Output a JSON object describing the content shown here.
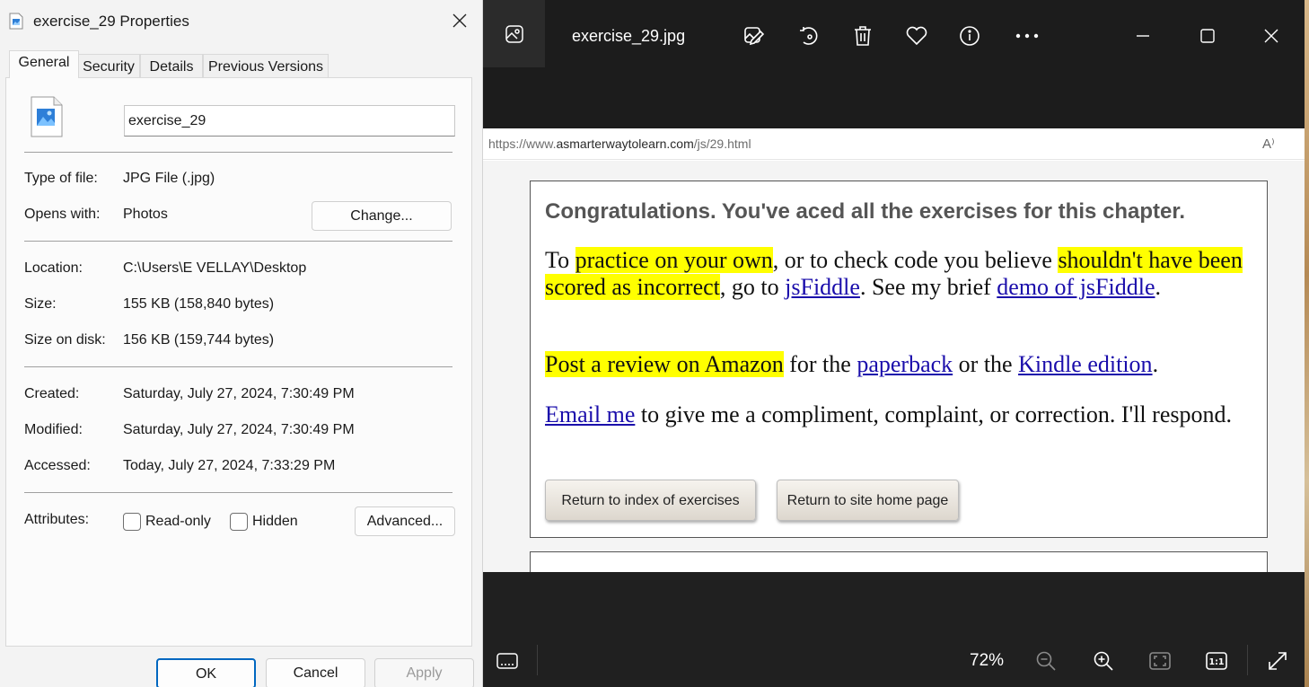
{
  "dialog": {
    "title": "exercise_29 Properties",
    "tabs": [
      "General",
      "Security",
      "Details",
      "Previous Versions"
    ],
    "file_name": "exercise_29",
    "type_label": "Type of file:",
    "type_value": "JPG File (.jpg)",
    "opens_label": "Opens with:",
    "opens_value": "Photos",
    "change_label": "Change...",
    "location_label": "Location:",
    "location_value": "C:\\Users\\E VELLAY\\Desktop",
    "size_label": "Size:",
    "size_value": "155 KB (158,840 bytes)",
    "size_disk_label": "Size on disk:",
    "size_disk_value": "156 KB (159,744 bytes)",
    "created_label": "Created:",
    "created_value": "Saturday, July 27, 2024, 7:30:49 PM",
    "modified_label": "Modified:",
    "modified_value": "Saturday, July 27, 2024, 7:30:49 PM",
    "accessed_label": "Accessed:",
    "accessed_value": "Today, July 27, 2024, 7:33:29 PM",
    "attributes_label": "Attributes:",
    "readonly_label": "Read-only",
    "hidden_label": "Hidden",
    "advanced_label": "Advanced...",
    "ok_label": "OK",
    "cancel_label": "Cancel",
    "apply_label": "Apply"
  },
  "viewer": {
    "title": "exercise_29.jpg",
    "zoom": "72%",
    "accent": "#0067c0",
    "toolbar_icons": [
      "edit-image-icon",
      "rotate-icon",
      "delete-icon",
      "favorite-icon",
      "info-icon",
      "more-icon"
    ],
    "image": {
      "url_prefix": "https://www.",
      "url_domain": "asmarterwaytolearn.com",
      "url_path": "/js/29.html",
      "reader_glyph": "A⁾",
      "congrats": "Congratulations. You've aced all the exercises for this chapter.",
      "p1": {
        "a": "To ",
        "hl1": "practice on your own",
        "b": ", or to check code you believe ",
        "hl2": "shouldn't have been scored as incorrect",
        "c": ", go to ",
        "link1": "jsFiddle",
        "d": ". See my brief ",
        "link2": "demo of jsFiddle",
        "e": "."
      },
      "p2": {
        "hl": "Post a review on Amazon",
        "a": " for the ",
        "link1": "paperback",
        "b": " or the ",
        "link2": "Kindle edition",
        "c": "."
      },
      "p3": {
        "link": "Email me",
        "a": " to give me a compliment, complaint, or correction. I'll respond."
      },
      "btn_index": "Return to index of exercises",
      "btn_home": "Return to site home page"
    }
  }
}
